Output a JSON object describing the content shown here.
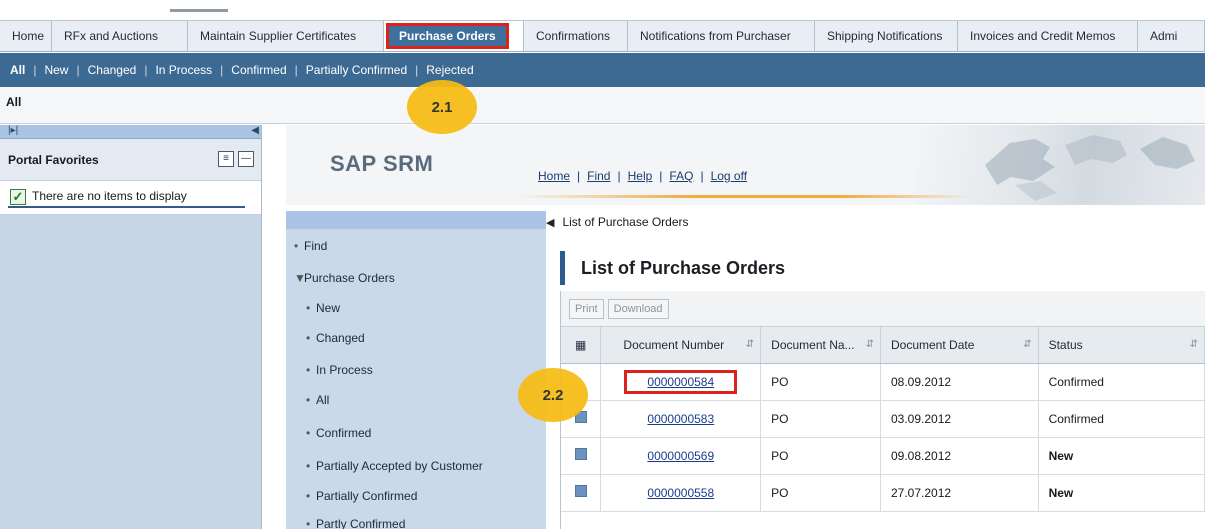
{
  "tabs": [
    {
      "label": "Home"
    },
    {
      "label": "RFx and Auctions"
    },
    {
      "label": "Maintain Supplier Certificates"
    },
    {
      "label": "Purchase Orders",
      "active": true
    },
    {
      "label": "Confirmations"
    },
    {
      "label": "Notifications from Purchaser"
    },
    {
      "label": "Shipping Notifications"
    },
    {
      "label": "Invoices and Credit Memos"
    },
    {
      "label": "Admi"
    }
  ],
  "subnav": {
    "items": [
      "All",
      "New",
      "Changed",
      "In Process",
      "Confirmed",
      "Partially Confirmed",
      "Rejected"
    ],
    "separator": "|"
  },
  "context": {
    "label": "All"
  },
  "portal": {
    "title": "Portal Favorites",
    "empty_message": "There are no items to display"
  },
  "srm": {
    "logo": "SAP SRM",
    "links": [
      "Home",
      "Find",
      "Help",
      "FAQ",
      "Log off"
    ]
  },
  "nav": {
    "find": "Find",
    "section": "Purchase Orders",
    "items": [
      "New",
      "Changed",
      "In Process",
      "All",
      "Confirmed",
      "Partially Accepted by Customer",
      "Partially Confirmed",
      "Partly Confirmed"
    ]
  },
  "content": {
    "breadcrumb": "List of Purchase Orders",
    "title": "List of Purchase Orders",
    "buttons": {
      "print": "Print",
      "download": "Download"
    },
    "columns": [
      "Document Number",
      "Document Na...",
      "Document Date",
      "Status"
    ],
    "rows": [
      {
        "number": "0000000584",
        "name": "PO",
        "date": "08.09.2012",
        "status": "Confirmed"
      },
      {
        "number": "0000000583",
        "name": "PO",
        "date": "03.09.2012",
        "status": "Confirmed"
      },
      {
        "number": "0000000569",
        "name": "PO",
        "date": "09.08.2012",
        "status": "New"
      },
      {
        "number": "0000000558",
        "name": "PO",
        "date": "27.07.2012",
        "status": "New"
      }
    ]
  },
  "callouts": {
    "first": "2.1",
    "second": "2.2"
  },
  "colors": {
    "highlight": "#d9231c",
    "callout": "#f7bc12",
    "nav_bar": "#3d6a93"
  }
}
